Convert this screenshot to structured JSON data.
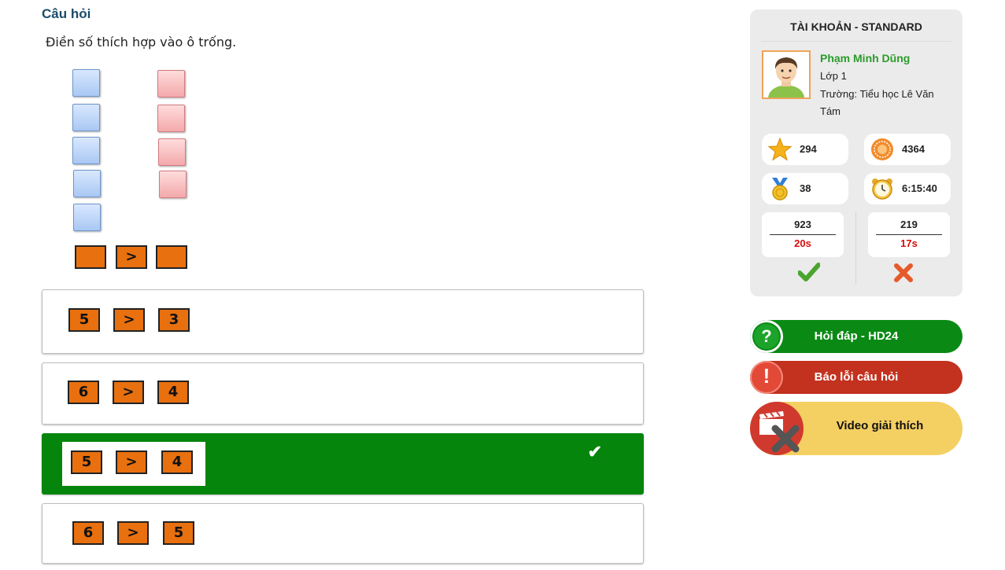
{
  "question": {
    "title": "Câu hỏi",
    "prompt": "Điền số thích hợp vào ô trống.",
    "operator": ">"
  },
  "answers": [
    {
      "left": "5",
      "op": ">",
      "right": "3",
      "selected": false
    },
    {
      "left": "6",
      "op": ">",
      "right": "4",
      "selected": false
    },
    {
      "left": "5",
      "op": ">",
      "right": "4",
      "selected": true
    },
    {
      "left": "6",
      "op": ">",
      "right": "5",
      "selected": false
    }
  ],
  "account": {
    "title": "TÀI KHOẢN - STANDARD",
    "name": "Phạm Minh Dũng",
    "class": "Lớp 1",
    "school_line1": "Trường: Tiểu học Lê Văn",
    "school_line2": "Tám",
    "stars": "294",
    "coins": "4364",
    "medals": "38",
    "time": "6:15:40",
    "correct_count": "923",
    "correct_time": "20s",
    "wrong_count": "219",
    "wrong_time": "17s"
  },
  "actions": {
    "help": "Hỏi đáp - HD24",
    "report": "Báo lỗi câu hỏi",
    "video": "Video giải thích"
  },
  "colors": {
    "box_orange": "#e8700f",
    "selected_green": "#06850c",
    "help_green": "#0a8a15",
    "report_red": "#c3311f",
    "video_yellow": "#f4cf62"
  }
}
